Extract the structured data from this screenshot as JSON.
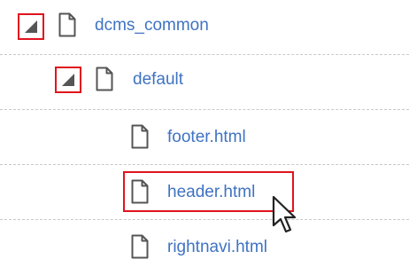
{
  "tree": {
    "items": [
      {
        "label": "dcms_common",
        "type": "folder",
        "expanded": true,
        "icon": "file-icon",
        "toggle_icon": "collapse-triangle-icon"
      },
      {
        "label": "default",
        "type": "folder",
        "expanded": true,
        "icon": "file-icon",
        "toggle_icon": "collapse-triangle-icon"
      },
      {
        "label": "footer.html",
        "type": "file",
        "icon": "file-icon"
      },
      {
        "label": "header.html",
        "type": "file",
        "icon": "file-icon",
        "highlighted": true
      },
      {
        "label": "rightnavi.html",
        "type": "file",
        "icon": "file-icon"
      }
    ]
  },
  "colors": {
    "link": "#3f73c2",
    "highlight_border": "#e0141e",
    "icon_stroke": "#555555",
    "divider": "#c9c9c9"
  },
  "cursor": {
    "icon": "mouse-pointer-icon"
  }
}
